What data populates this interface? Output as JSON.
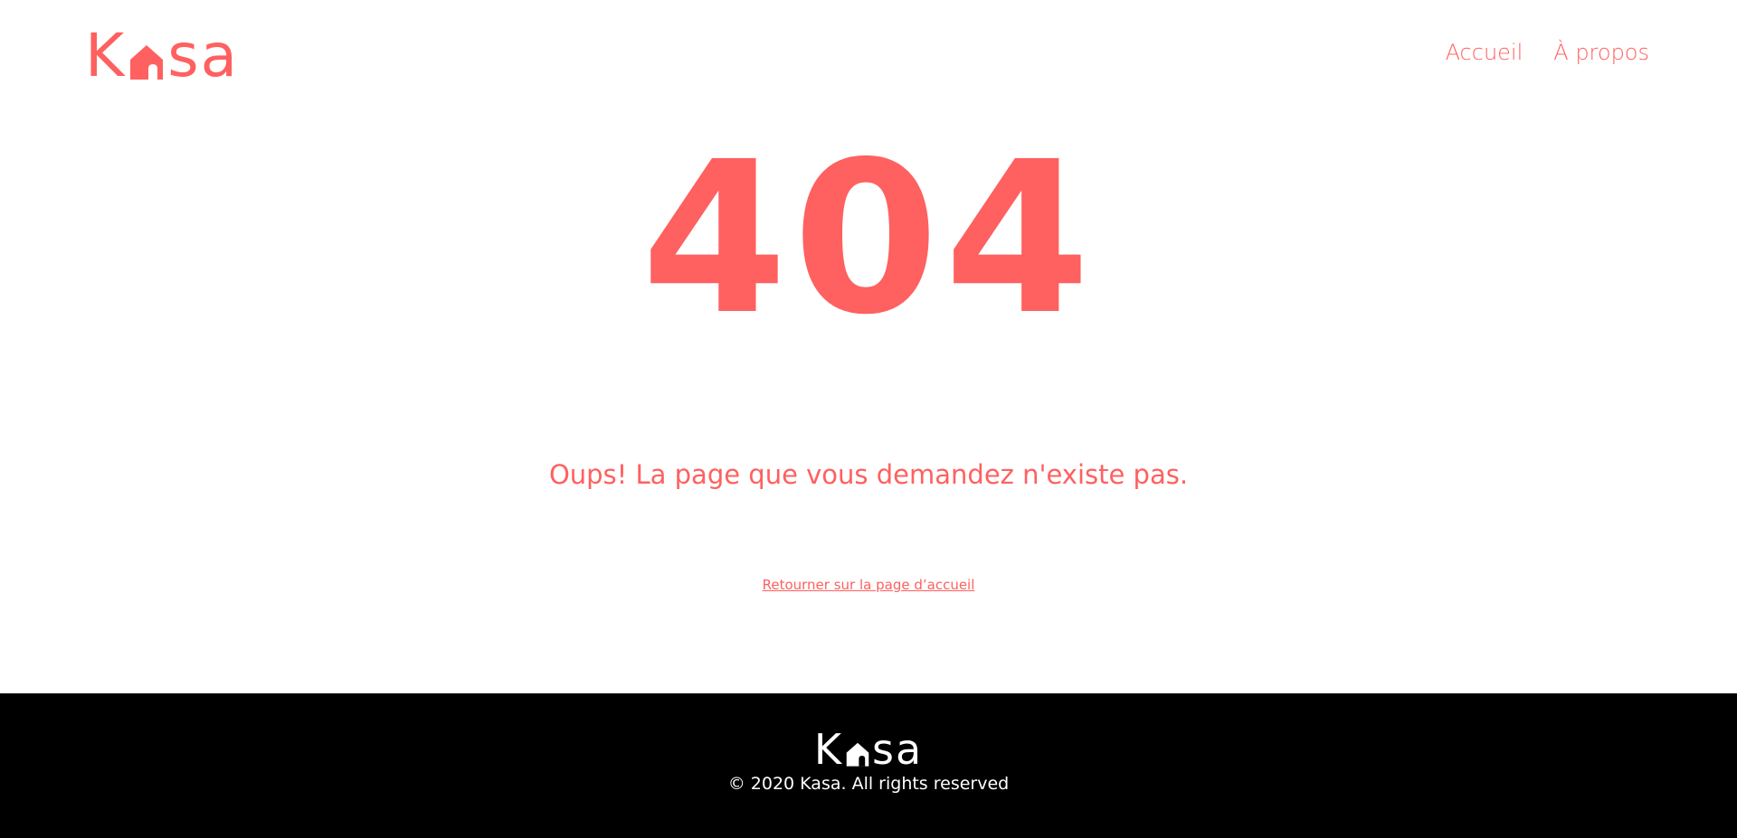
{
  "colors": {
    "accent": "#ff6060",
    "footer_bg": "#000000",
    "footer_text": "#ffffff",
    "page_bg": "#ffffff"
  },
  "header": {
    "logo": {
      "first_letter": "K",
      "rest": "sa",
      "icon": "house-icon"
    },
    "nav": [
      {
        "label": "Accueil"
      },
      {
        "label": "À propos"
      }
    ]
  },
  "main": {
    "error_code": "404",
    "message": "Oups! La page que vous demandez n'existe pas.",
    "back_link": "Retourner sur la page d’accueil"
  },
  "footer": {
    "logo": {
      "first_letter": "K",
      "rest": "sa",
      "icon": "house-icon"
    },
    "copyright": "© 2020 Kasa. All rights reserved"
  }
}
